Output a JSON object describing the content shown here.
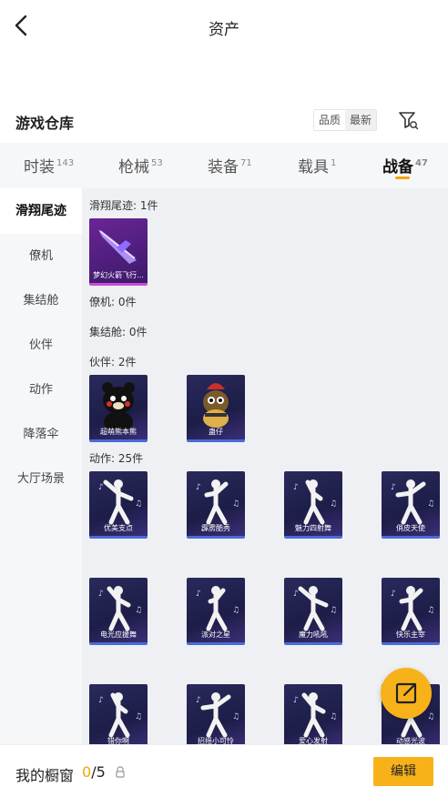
{
  "header": {
    "title": "资产"
  },
  "section": {
    "title": "游戏仓库",
    "sort_options": [
      "品质",
      "最新"
    ],
    "active_sort": "最新"
  },
  "tabs": [
    {
      "label": "时装",
      "count": "143"
    },
    {
      "label": "枪械",
      "count": "53"
    },
    {
      "label": "装备",
      "count": "71"
    },
    {
      "label": "载具",
      "count": "1"
    },
    {
      "label": "战备",
      "count": "47"
    }
  ],
  "active_tab": "战备",
  "sidebar": {
    "items": [
      "滑翔尾迹",
      "僚机",
      "集结舱",
      "伙伴",
      "动作",
      "降落伞",
      "大厅场景"
    ],
    "active": "滑翔尾迹"
  },
  "groups": {
    "trail": {
      "title": "滑翔尾迹: 1件",
      "items": [
        {
          "label": "梦幻火箭飞行..."
        }
      ]
    },
    "wingman": {
      "title": "僚机: 0件"
    },
    "pod": {
      "title": "集结舱: 0件"
    },
    "partner": {
      "title": "伙伴: 2件",
      "items": [
        {
          "label": "超萌熊本熊"
        },
        {
          "label": "蛊仔"
        }
      ]
    },
    "emote": {
      "title": "动作: 25件",
      "items": [
        {
          "label": "优美支点"
        },
        {
          "label": "霹雳酷秀"
        },
        {
          "label": "魅力四射舞"
        },
        {
          "label": "俏皮天使"
        },
        {
          "label": "电光应援舞"
        },
        {
          "label": "派对之星"
        },
        {
          "label": "魔力吼吼"
        },
        {
          "label": "快乐主宰"
        },
        {
          "label": "错你啊"
        },
        {
          "label": "招摇小可怜"
        },
        {
          "label": "爱心发射"
        },
        {
          "label": "动感光波"
        }
      ]
    }
  },
  "footer": {
    "label": "我的橱窗",
    "current": "0",
    "total": "/5",
    "edit_label": "编辑"
  },
  "colors": {
    "accent": "#f7b21a",
    "underline": "#f5a500",
    "card_bg": "#1d1d48",
    "rare_border": "#c94bd6"
  }
}
